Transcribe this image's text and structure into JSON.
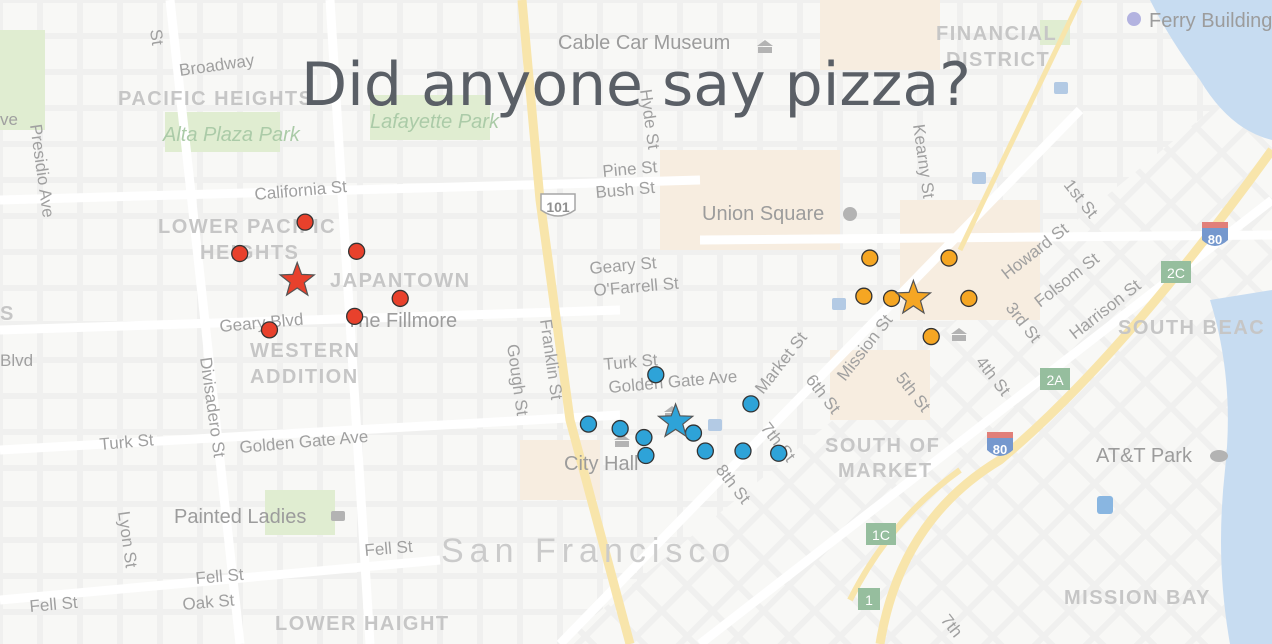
{
  "title": "Did anyone say pizza?",
  "colors": {
    "red": "#e8412c",
    "blue": "#2ea3d8",
    "orange": "#f5a623",
    "water": "#a9c9ea",
    "park": "#cfe3b8"
  },
  "labels": {
    "ferry_building": "Ferry Building",
    "cable_car_museum": "Cable Car Museum",
    "financial_district_1": "FINANCIAL",
    "financial_district_2": "DISTRICT",
    "broadway": "Broadway",
    "pacific_heights": "PACIFIC HEIGHTS",
    "alta_plaza_park": "Alta Plaza Park",
    "lafayette_park": "Lafayette Park",
    "presidio_ave": "Presidio Ave",
    "california_st": "California St",
    "pine_st": "Pine St",
    "bush_st": "Bush St",
    "hwy_101": "101",
    "union_square": "Union Square",
    "lower_pacific_heights_1": "LOWER PACIFIC",
    "lower_pacific_heights_2": "HEIGHTS",
    "japantown": "JAPANTOWN",
    "geary_st": "Geary St",
    "ofarrell_st": "O'Farrell St",
    "geary_blvd": "Geary Blvd",
    "the_fillmore": "The Fillmore",
    "western_addition_1": "WESTERN",
    "western_addition_2": "ADDITION",
    "franklin_st": "Franklin St",
    "gough_st": "Gough St",
    "turk_st_east": "Turk St",
    "golden_gate_ave_east": "Golden Gate Ave",
    "divisadero_st": "Divisadero St",
    "turk_st_west": "Turk St",
    "golden_gate_ave_west": "Golden Gate Ave",
    "city_hall": "City Hall",
    "market_st": "Market St",
    "mission_st": "Mission St",
    "sixth_st": "6th St",
    "fifth_st": "5th St",
    "fourth_st": "4th St",
    "third_st": "3rd St",
    "seventh_st": "7th St",
    "eighth_st": "8th St",
    "first_st": "1st St",
    "howard_st": "Howard St",
    "folsom_st": "Folsom St",
    "harrison_st": "Harrison St",
    "kearny_st": "Kearny St",
    "south_beach": "SOUTH BEAC",
    "south_of_market_1": "SOUTH OF",
    "south_of_market_2": "MARKET",
    "att_park": "AT&T Park",
    "i80_top": "80",
    "i80_mid": "80",
    "exit_2c": "2C",
    "exit_2a": "2A",
    "exit_1c": "1C",
    "exit_1": "1",
    "painted_ladies": "Painted Ladies",
    "lyon_st": "Lyon St",
    "fell_st_mid": "Fell St",
    "fell_st_left": "Fell St",
    "fell_st_bottom": "Fell St",
    "oak_st": "Oak St",
    "san_francisco": "San Francisco",
    "lower_haight": "LOWER HAIGHT",
    "mission_bay": "MISSION BAY",
    "blvd_edge": "Blvd",
    "s_edge": "S",
    "st_edge": "St",
    "ve_edge": "ve",
    "hyde_st": "Hyde St",
    "divisadero_top": "Divisadero St",
    "sixth_seventh_bottom": "7th"
  },
  "clusters": [
    {
      "name": "red",
      "color": "#e8412c",
      "star": [
        -122.4371,
        37.7848
      ],
      "points": [
        [
          -122.4367,
          37.7874
        ],
        [
          -122.44,
          37.786
        ],
        [
          -122.4341,
          37.7861
        ],
        [
          -122.4319,
          37.784
        ],
        [
          -122.4342,
          37.7832
        ],
        [
          -122.4385,
          37.7826
        ]
      ]
    },
    {
      "name": "blue",
      "color": "#2ea3d8",
      "star": [
        -122.418,
        37.7785
      ],
      "points": [
        [
          -122.419,
          37.7806
        ],
        [
          -122.4224,
          37.7784
        ],
        [
          -122.4208,
          37.7782
        ],
        [
          -122.4196,
          37.7778
        ],
        [
          -122.4171,
          37.778
        ],
        [
          -122.4165,
          37.7772
        ],
        [
          -122.4195,
          37.777
        ],
        [
          -122.4142,
          37.7793
        ],
        [
          -122.4146,
          37.7772
        ],
        [
          -122.4128,
          37.7771
        ]
      ]
    },
    {
      "name": "orange",
      "color": "#f5a623",
      "star": [
        -122.406,
        37.784
      ],
      "points": [
        [
          -122.4082,
          37.7858
        ],
        [
          -122.4042,
          37.7858
        ],
        [
          -122.4085,
          37.7841
        ],
        [
          -122.4071,
          37.784
        ],
        [
          -122.4032,
          37.784
        ],
        [
          -122.4051,
          37.7823
        ]
      ]
    }
  ]
}
